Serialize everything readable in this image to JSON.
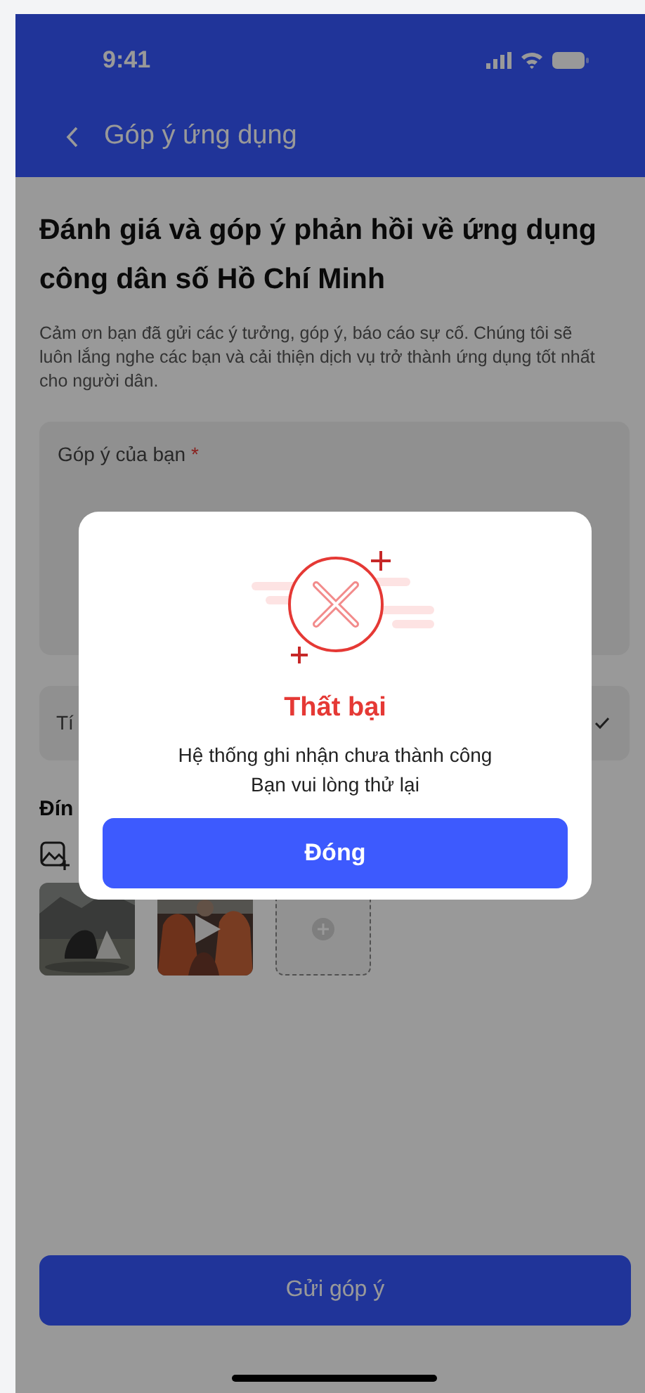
{
  "status_bar": {
    "time": "9:41"
  },
  "header": {
    "title": "Góp ý ứng dụng"
  },
  "page": {
    "heading": "Đánh giá và góp ý phản hồi về ứng dụng công dân số Hồ Chí Minh",
    "description": "Cảm ơn bạn đã gửi các ý tưởng, góp ý, báo cáo sự cố. Chúng tôi sẽ luôn lắng nghe các bạn và cải thiện dịch vụ trở thành ứng dụng tốt nhất cho người dân.",
    "feedback_field": {
      "label": "Góp ý của bạn",
      "required_mark": "*"
    },
    "field_2": {
      "label": "Tí"
    },
    "attachments": {
      "label": "Đín",
      "items": [
        {
          "kind": "picture"
        },
        {
          "kind": "video"
        },
        {
          "kind": "add"
        }
      ]
    },
    "submit_button": "Gửi góp ý"
  },
  "dialog": {
    "title": "Thất bại",
    "message_lines": [
      "Hệ thống ghi nhận chưa thành công",
      "Bạn vui lòng thử lại"
    ],
    "button": "Đóng"
  }
}
